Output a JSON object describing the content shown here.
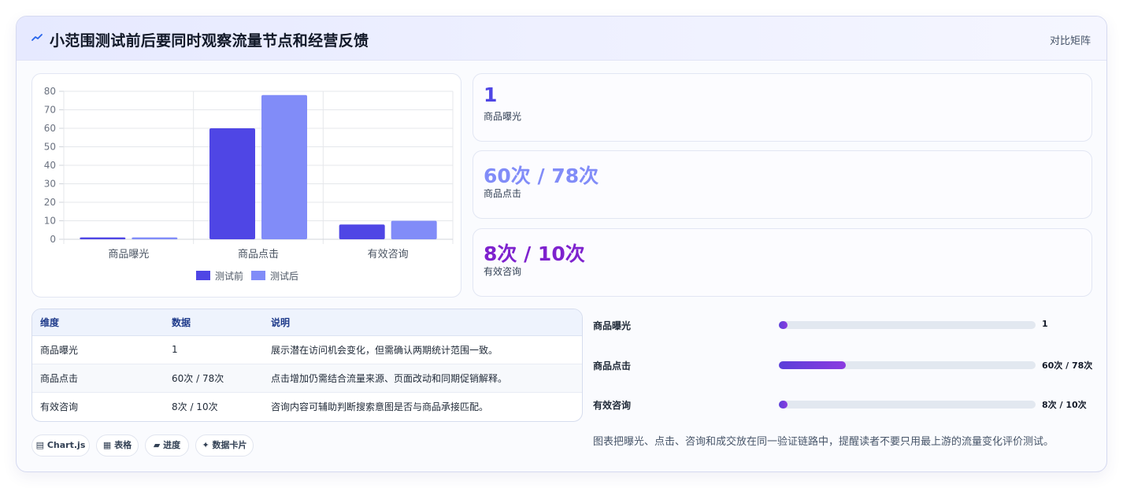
{
  "header": {
    "title": "小范围测试前后要同时观察流量节点和经营反馈",
    "tag": "对比矩阵",
    "icon": "trend-line-icon"
  },
  "colors": {
    "before": "#4f46e5",
    "after": "#818cf8",
    "kpi1": "#4f46e5",
    "kpi2": "#818cf8",
    "kpi3": "#7e22ce"
  },
  "chart_data": {
    "type": "bar",
    "categories": [
      "商品曝光",
      "商品点击",
      "有效咨询"
    ],
    "series": [
      {
        "name": "测试前",
        "values": [
          1,
          60,
          8
        ]
      },
      {
        "name": "测试后",
        "values": [
          1,
          78,
          10
        ]
      }
    ],
    "yticks": [
      0,
      10,
      20,
      30,
      40,
      50,
      60,
      70,
      80
    ],
    "ylim": [
      0,
      80
    ],
    "legend": "bottom",
    "grid": true
  },
  "kpis": [
    {
      "value": "1",
      "label": "商品曝光"
    },
    {
      "value": "60次 / 78次",
      "label": "商品点击"
    },
    {
      "value": "8次 / 10次",
      "label": "有效咨询"
    }
  ],
  "table": {
    "headers": [
      "维度",
      "数据",
      "说明"
    ],
    "rows": [
      [
        "商品曝光",
        "1",
        "展示潜在访问机会变化，但需确认两期统计范围一致。"
      ],
      [
        "商品点击",
        "60次 / 78次",
        "点击增加仍需结合流量来源、页面改动和同期促销解释。"
      ],
      [
        "有效咨询",
        "8次 / 10次",
        "咨询内容可辅助判断搜索意图是否与商品承接匹配。"
      ]
    ]
  },
  "progress": [
    {
      "label": "商品曝光",
      "value": "1",
      "fill": 0.02
    },
    {
      "label": "商品点击",
      "value": "60次 / 78次",
      "fill": 0.26
    },
    {
      "label": "有效咨询",
      "value": "8次 / 10次",
      "fill": 0.03
    }
  ],
  "note": "图表把曝光、点击、咨询和成交放在同一验证链路中，提醒读者不要只用最上游的流量变化评价测试。",
  "chips": [
    {
      "icon": "chart-icon",
      "glyph": "▤",
      "label": "Chart.js"
    },
    {
      "icon": "table-icon",
      "glyph": "▦",
      "label": "表格"
    },
    {
      "icon": "progress-icon",
      "glyph": "▰",
      "label": "进度"
    },
    {
      "icon": "sparkle-icon",
      "glyph": "✦",
      "label": "数据卡片"
    }
  ]
}
